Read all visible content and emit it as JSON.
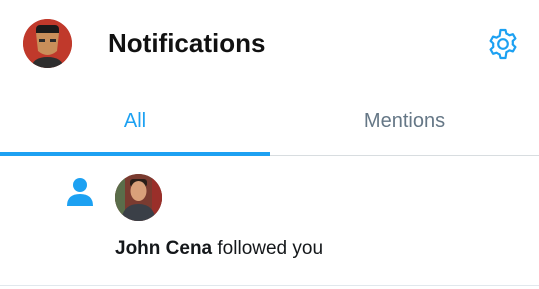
{
  "header": {
    "title": "Notifications",
    "avatar_icon": "user-avatar",
    "settings_icon": "gear-icon"
  },
  "tabs": [
    {
      "label": "All",
      "active": true
    },
    {
      "label": "Mentions",
      "active": false
    }
  ],
  "notifications": [
    {
      "type_icon": "person-icon",
      "user_name": "John Cena",
      "action_text": " followed you"
    }
  ],
  "colors": {
    "accent": "#1da1f2",
    "inactive_tab": "#657786",
    "text": "#14171a"
  }
}
